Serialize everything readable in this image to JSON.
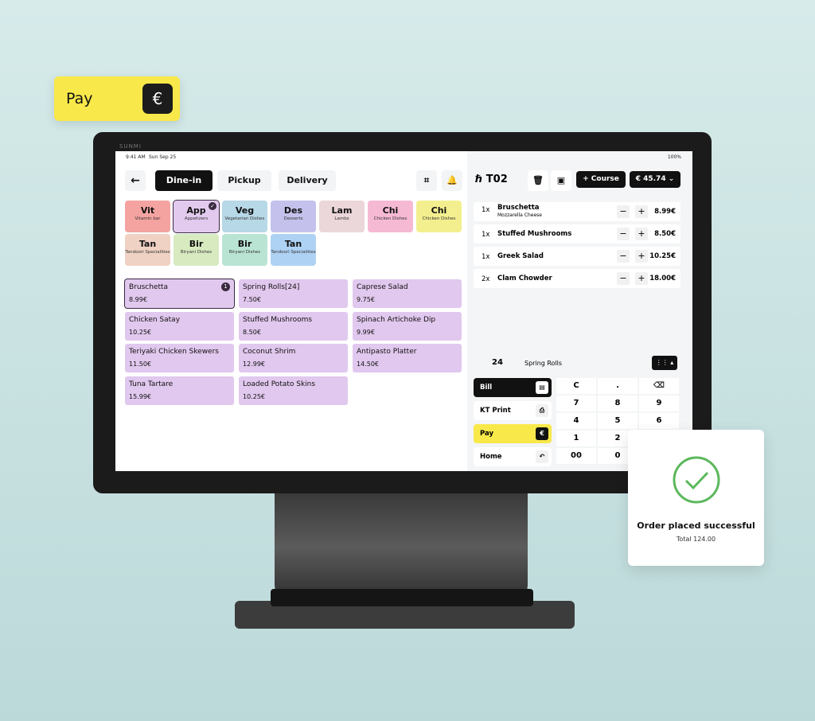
{
  "pay_badge": {
    "label": "Pay",
    "icon": "euro-icon",
    "symbol": "€"
  },
  "device": {
    "brand": "SUNMI"
  },
  "status_bar": {
    "time": "9:41 AM",
    "date": "Sun Sep 25",
    "battery": "100%"
  },
  "order_tabs": [
    {
      "label": "Dine-in",
      "active": true
    },
    {
      "label": "Pickup"
    },
    {
      "label": "Delivery"
    }
  ],
  "categories": [
    {
      "abbr": "Vit",
      "name": "Vitamin bar",
      "color": "#f4a3a0"
    },
    {
      "abbr": "App",
      "name": "Appetizers",
      "color": "#e2caef",
      "selected": true
    },
    {
      "abbr": "Veg",
      "name": "Vegetarian Dishes",
      "color": "#b7d8e6"
    },
    {
      "abbr": "Des",
      "name": "Desserts",
      "color": "#c4c2ec"
    },
    {
      "abbr": "Lam",
      "name": "Lambs",
      "color": "#ebd6da"
    },
    {
      "abbr": "Chi",
      "name": "Chicken Dishes",
      "color": "#f6b9d4"
    },
    {
      "abbr": "Chi",
      "name": "Chicken Dishes",
      "color": "#f3ef8f"
    },
    {
      "abbr": "Tan",
      "name": "Tandoori Specialities",
      "color": "#efd2c4"
    },
    {
      "abbr": "Bir",
      "name": "Biryani Dishes",
      "color": "#d8eac0"
    },
    {
      "abbr": "Bir",
      "name": "Biryani Dishes",
      "color": "#b9e4d4"
    },
    {
      "abbr": "Tan",
      "name": "Tandoori Specialities",
      "color": "#aed2f4"
    }
  ],
  "menu_items": [
    {
      "name": "Bruschetta",
      "price": "8.99€",
      "badge": "1"
    },
    {
      "name": "Spring Rolls[24]",
      "price": "7.50€"
    },
    {
      "name": "Caprese Salad",
      "price": "9.75€"
    },
    {
      "name": "Chicken Satay",
      "price": "10.25€"
    },
    {
      "name": "Stuffed Mushrooms",
      "price": "8.50€"
    },
    {
      "name": "Spinach Artichoke Dip",
      "price": "9.99€"
    },
    {
      "name": "Teriyaki Chicken Skewers",
      "price": "11.50€"
    },
    {
      "name": "Coconut Shrim",
      "price": "12.99€"
    },
    {
      "name": "Antipasto Platter",
      "price": "14.50€"
    },
    {
      "name": "Tuna Tartare",
      "price": "15.99€"
    },
    {
      "name": "Loaded Potato Skins",
      "price": "10.25€"
    }
  ],
  "order": {
    "table": "T02",
    "course_label": "+ Course",
    "total": "€ 45.74",
    "lines": [
      {
        "qty": "1x",
        "name": "Bruschetta",
        "note": "Mozzarella Cheese",
        "price": "8.99€"
      },
      {
        "qty": "1x",
        "name": "Stuffed Mushrooms",
        "price": "8.50€"
      },
      {
        "qty": "1x",
        "name": "Greek Salad",
        "price": "10.25€"
      },
      {
        "qty": "2x",
        "name": "Clam Chowder",
        "price": "18.00€"
      }
    ]
  },
  "entry": {
    "qty": "24",
    "item": "Spring Rolls"
  },
  "actions": [
    {
      "label": "Bill",
      "icon": "receipt-icon"
    },
    {
      "label": "KT Print",
      "icon": "printer-icon"
    },
    {
      "label": "Pay",
      "icon": "euro-icon"
    },
    {
      "label": "Home",
      "icon": "return-icon"
    }
  ],
  "keypad": [
    "C",
    ".",
    "⌫",
    "7",
    "8",
    "9",
    "4",
    "5",
    "6",
    "1",
    "2",
    "",
    "00",
    "0",
    ""
  ],
  "accent": "#f9e84a",
  "success": {
    "title": "Order placed successful",
    "total": "Total 124.00",
    "color": "#5cb85c"
  }
}
